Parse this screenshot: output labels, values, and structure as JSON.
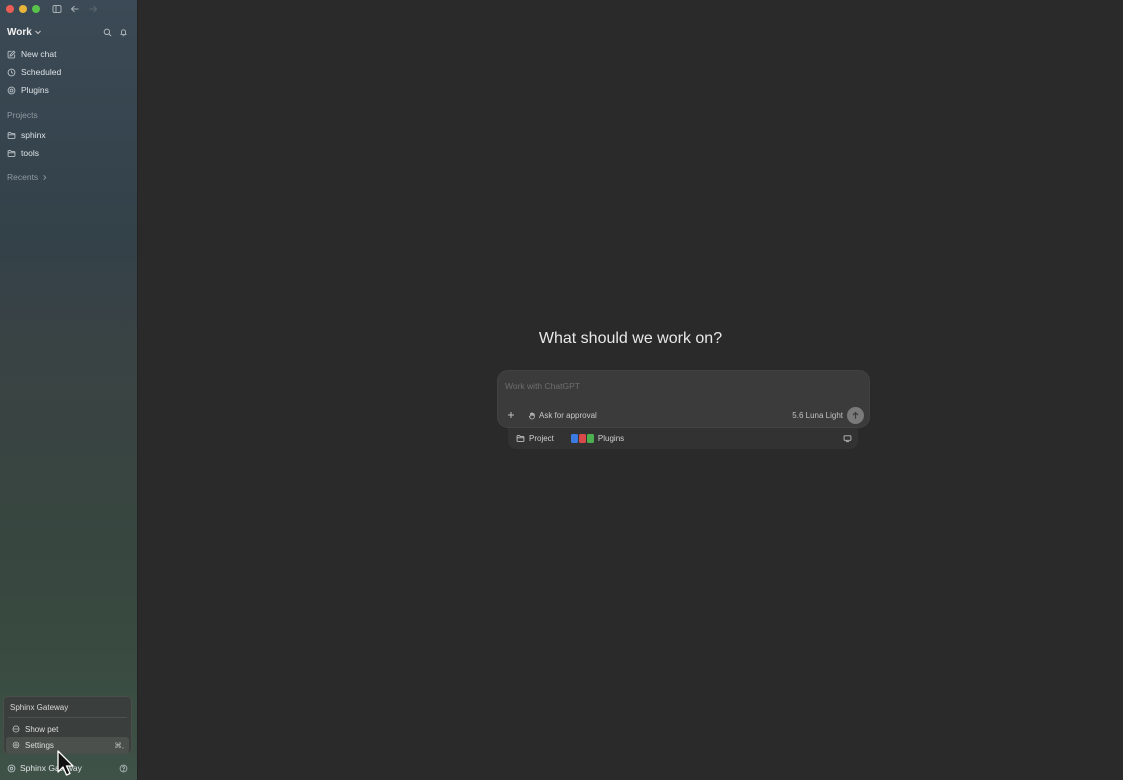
{
  "sidebar": {
    "workspace_title": "Work",
    "nav": [
      {
        "label": "New chat",
        "icon": "edit-icon"
      },
      {
        "label": "Scheduled",
        "icon": "clock-icon"
      },
      {
        "label": "Plugins",
        "icon": "plugin-icon"
      }
    ],
    "projects_label": "Projects",
    "projects": [
      {
        "label": "sphinx",
        "icon": "folder-icon"
      },
      {
        "label": "tools",
        "icon": "folder-icon"
      }
    ],
    "recents_label": "Recents",
    "bottom_label": "Sphinx Gateway"
  },
  "popup_menu": {
    "title": "Sphinx Gateway",
    "items": [
      {
        "label": "Show pet",
        "icon": "pet-icon"
      },
      {
        "label": "Settings",
        "icon": "gear-icon",
        "shortcut": "⌘,"
      }
    ]
  },
  "main": {
    "heading": "What should we work on?",
    "composer": {
      "placeholder": "Work with ChatGPT",
      "approval_label": "Ask for approval",
      "model_label": "5.6 Luna  Light"
    },
    "subbar": {
      "project_label": "Project",
      "plugins_label": "Plugins"
    }
  },
  "colors": {
    "background": "#2a2a2a",
    "composer": "#3b3b3b",
    "traffic_red": "#ee5d55",
    "traffic_yellow": "#e6b43a",
    "traffic_green": "#58c24a",
    "plugin_blue": "#3b7be0",
    "plugin_red": "#d84a4a",
    "plugin_green": "#4caf50"
  }
}
